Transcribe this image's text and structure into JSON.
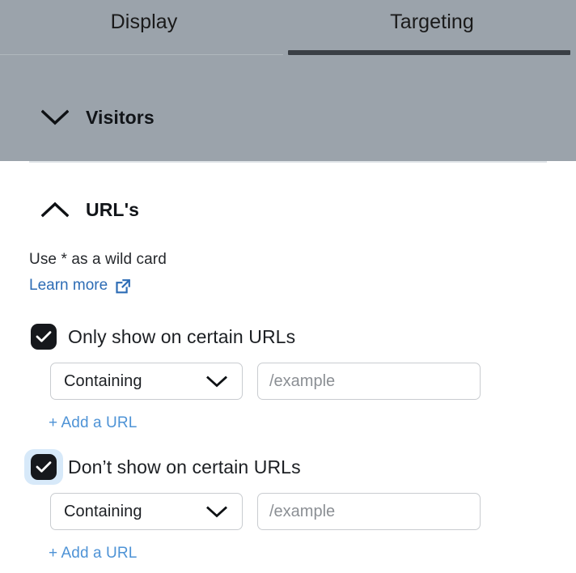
{
  "tabs": [
    {
      "label": "Display",
      "active": false,
      "name": "tab-display"
    },
    {
      "label": "Targeting",
      "active": true,
      "name": "tab-targeting"
    }
  ],
  "sections": {
    "visitors": {
      "title": "Visitors",
      "expanded": false,
      "chevron_icon": "chevron-down-icon"
    },
    "urls": {
      "title": "URL's",
      "expanded": true,
      "chevron_icon": "chevron-up-icon",
      "hint": "Use * as a wild card",
      "learn_more": {
        "label": "Learn more",
        "icon": "external-link-icon"
      },
      "rules": [
        {
          "id": "only-show",
          "label": "Only show on certain URLs",
          "checked": true,
          "focused": false,
          "match_type": "Containing",
          "match_options": [
            "Containing"
          ],
          "url_value": "",
          "url_placeholder": "/example",
          "add_link": "+ Add a URL"
        },
        {
          "id": "dont-show",
          "label": "Don’t show on certain URLs",
          "checked": true,
          "focused": true,
          "match_type": "Containing",
          "match_options": [
            "Containing"
          ],
          "url_value": "",
          "url_placeholder": "/example",
          "add_link": "+ Add a URL"
        }
      ]
    }
  },
  "colors": {
    "overlay_grey": "#9ba3ab",
    "active_tab_underline": "#3a3f45",
    "checkbox_fill": "#16181c",
    "focus_ring": "#d7e9f9",
    "link_blue": "#2d6cb5",
    "add_link_blue": "#4e93d6",
    "input_border": "#c9ccd0",
    "placeholder_grey": "#8b8f94"
  }
}
